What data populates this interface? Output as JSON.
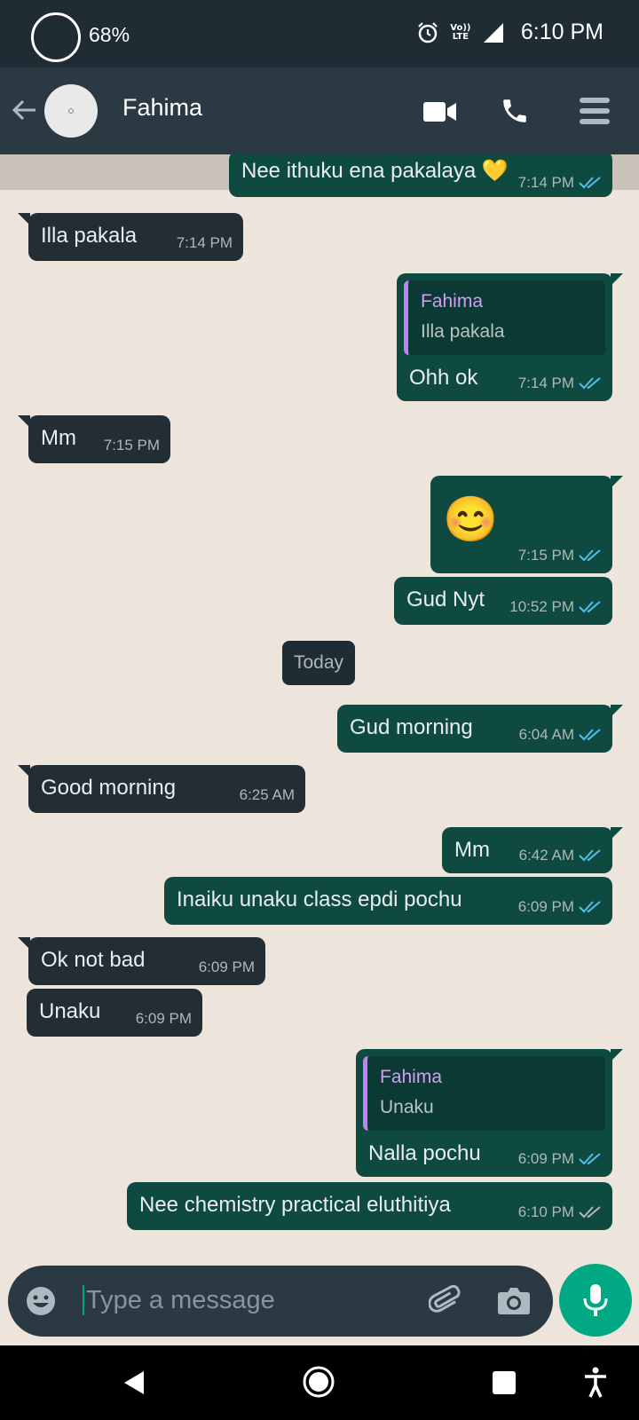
{
  "status_bar": {
    "battery": "68%",
    "network": "Vo)) LTE",
    "signal_label": "LTE",
    "time": "6:10 PM"
  },
  "header": {
    "contact_name": "Fahima"
  },
  "date_divider": "Today",
  "messages": [
    {
      "dir": "out",
      "text": "Nee ithuku ena pakalaya 💛",
      "time": "7:14 PM",
      "read": true
    },
    {
      "dir": "in",
      "text": "Illa pakala",
      "time": "7:14 PM"
    },
    {
      "dir": "out",
      "reply_to_name": "Fahima",
      "reply_to_text": "Illa pakala",
      "text": "Ohh ok",
      "time": "7:14 PM",
      "read": true
    },
    {
      "dir": "in",
      "text": "Mm",
      "time": "7:15 PM"
    },
    {
      "dir": "out",
      "text": "😊",
      "time": "7:15 PM",
      "read": true
    },
    {
      "dir": "out",
      "text": "Gud Nyt",
      "time": "10:52 PM",
      "read": true
    },
    {
      "dir": "out",
      "text": "Gud morning",
      "time": "6:04 AM",
      "read": true
    },
    {
      "dir": "in",
      "text": "Good morning",
      "time": "6:25 AM"
    },
    {
      "dir": "out",
      "text": "Mm",
      "time": "6:42 AM",
      "read": true
    },
    {
      "dir": "out",
      "text": "Inaiku unaku class epdi pochu",
      "time": "6:09 PM",
      "read": true
    },
    {
      "dir": "in",
      "text": "Ok not bad",
      "time": "6:09 PM"
    },
    {
      "dir": "in",
      "text": "Unaku",
      "time": "6:09 PM"
    },
    {
      "dir": "out",
      "reply_to_name": "Fahima",
      "reply_to_text": "Unaku",
      "text": "Nalla pochu",
      "time": "6:09 PM",
      "read": true
    },
    {
      "dir": "out",
      "text": "Nee chemistry practical eluthitiya",
      "time": "6:10 PM",
      "read": false
    }
  ],
  "composer": {
    "placeholder": "Type a message"
  },
  "colors": {
    "header_bg": "#2a3942",
    "outgoing_bubble": "#0e4a40",
    "incoming_bubble": "#232d34",
    "accent": "#00a884",
    "read_ticks": "#53bdeb",
    "wallpaper": "#ede4dc"
  },
  "icons": [
    "back-arrow-icon",
    "video-call-icon",
    "phone-icon",
    "menu-icon",
    "emoji-icon",
    "attach-icon",
    "camera-icon",
    "mic-icon",
    "nav-back-icon",
    "nav-home-icon",
    "nav-recents-icon",
    "accessibility-icon",
    "alarm-icon",
    "signal-icon"
  ]
}
